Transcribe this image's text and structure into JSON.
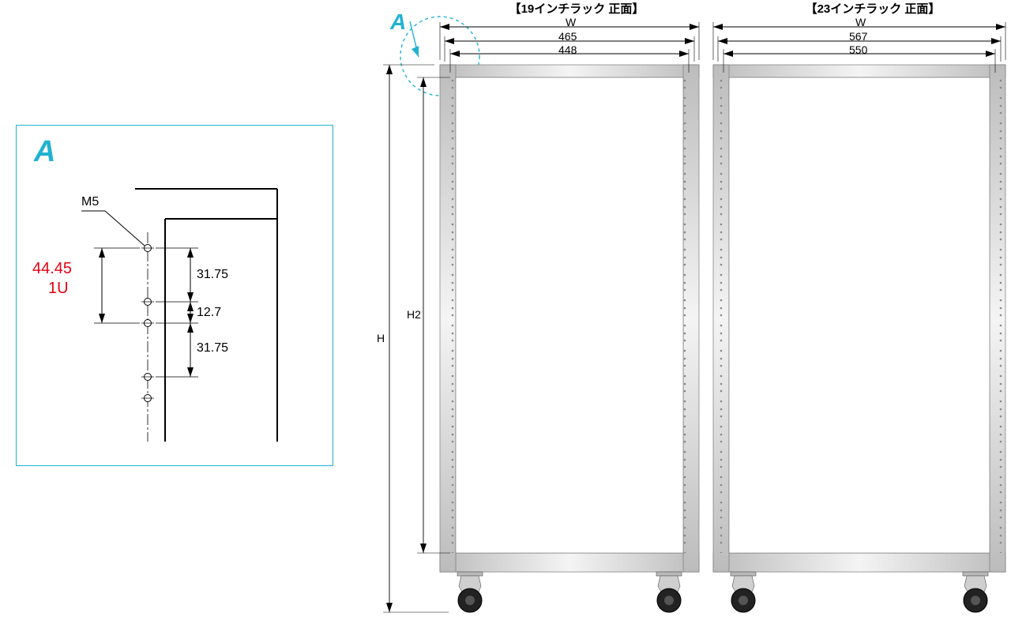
{
  "detail": {
    "label": "A",
    "m5_label": "M5",
    "u_height": "44.45",
    "u_label": "1U",
    "spacing_top": "31.75",
    "spacing_small": "12.7",
    "spacing_bot": "31.75"
  },
  "callout": {
    "label": "A"
  },
  "axes": {
    "h_label": "H",
    "h2_label": "H2",
    "w_label": "W"
  },
  "rack19": {
    "title": "【19インチラック 正面】",
    "width_outer": "465",
    "width_inner": "448"
  },
  "rack23": {
    "title": "【23インチラック 正面】",
    "width_outer": "567",
    "width_inner": "550"
  }
}
